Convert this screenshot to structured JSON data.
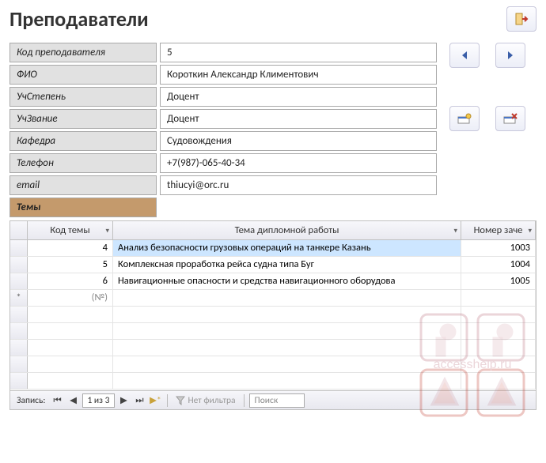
{
  "header": {
    "title": "Преподаватели"
  },
  "fields": {
    "code_lbl": "Код преподавателя",
    "code_val": "5",
    "fio_lbl": "ФИО",
    "fio_val": "Короткин Александр Климентович",
    "degree_lbl": "УчСтепень",
    "degree_val": "Доцент",
    "rank_lbl": "УчЗвание",
    "rank_val": "Доцент",
    "dept_lbl": "Кафедра",
    "dept_val": "Судовождения",
    "phone_lbl": "Телефон",
    "phone_val": "+7(987)-065-40-34",
    "email_lbl": "email",
    "email_val": "thiucyi@orc.ru",
    "themes_lbl": "Темы"
  },
  "grid": {
    "col1": "Код темы",
    "col2": "Тема дипломной работы",
    "col3": "Номер заче",
    "rows": [
      {
        "code": "4",
        "title": "Анализ безопасности грузовых операций на танкере Казань",
        "num": "1003"
      },
      {
        "code": "5",
        "title": "Комплексная проработка рейса судна типа Буг",
        "num": "1004"
      },
      {
        "code": "6",
        "title": "Навигационные опасности и средства навигационного оборудова",
        "num": "1005"
      }
    ],
    "new_placeholder": "(№)"
  },
  "nav": {
    "label": "Запись:",
    "pos": "1 из 3",
    "no_filter": "Нет фильтра",
    "search": "Поиск"
  },
  "watermark": "accesshelp.ru"
}
